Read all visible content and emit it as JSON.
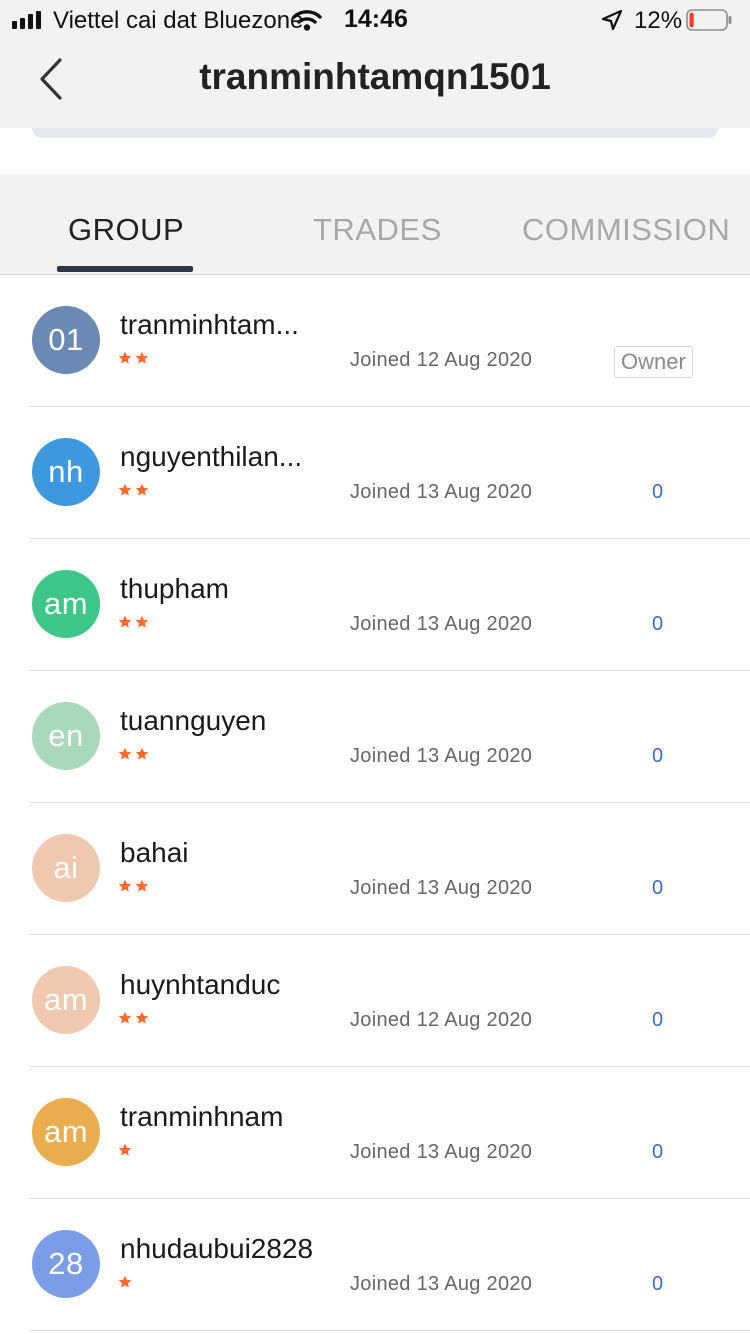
{
  "status_bar": {
    "carrier": "Viettel cai dat Bluezone",
    "time": "14:46",
    "battery_percent": "12%",
    "battery_level": 0.12,
    "battery_color": "#ff3b30",
    "icons": [
      "signal-icon",
      "wifi-icon",
      "location-arrow-icon",
      "battery-icon"
    ]
  },
  "header": {
    "title": "tranminhtamqn1501",
    "back_icon": "chevron-left-icon"
  },
  "tabs": [
    {
      "label": "GROUP",
      "active": true
    },
    {
      "label": "TRADES",
      "active": false
    },
    {
      "label": "COMMISSION",
      "active": false
    }
  ],
  "colors": {
    "star": "#ff6a2b",
    "link_value": "#3b6cc4",
    "tab_indicator": "#2e3648"
  },
  "members": [
    {
      "initials": "01",
      "avatar_color": "#6a8ab5",
      "name": "tranminhtam...",
      "stars": 2,
      "joined": "Joined 12 Aug 2020",
      "value": "Owner",
      "is_badge": true
    },
    {
      "initials": "nh",
      "avatar_color": "#3d98e0",
      "name": "nguyenthilan...",
      "stars": 2,
      "joined": "Joined 13 Aug 2020",
      "value": "0",
      "is_badge": false
    },
    {
      "initials": "am",
      "avatar_color": "#3ec689",
      "name": "thupham",
      "stars": 2,
      "joined": "Joined 13 Aug 2020",
      "value": "0",
      "is_badge": false
    },
    {
      "initials": "en",
      "avatar_color": "#a9d8ba",
      "name": "tuannguyen",
      "stars": 2,
      "joined": "Joined 13 Aug 2020",
      "value": "0",
      "is_badge": false
    },
    {
      "initials": "ai",
      "avatar_color": "#f0c8b0",
      "name": "bahai",
      "stars": 2,
      "joined": "Joined 13 Aug 2020",
      "value": "0",
      "is_badge": false
    },
    {
      "initials": "am",
      "avatar_color": "#f0c8b0",
      "name": "huynhtanduc",
      "stars": 2,
      "joined": "Joined 12 Aug 2020",
      "value": "0",
      "is_badge": false
    },
    {
      "initials": "am",
      "avatar_color": "#e9ad50",
      "name": "tranminhnam",
      "stars": 1,
      "joined": "Joined 13 Aug 2020",
      "value": "0",
      "is_badge": false
    },
    {
      "initials": "28",
      "avatar_color": "#7b9ce6",
      "name": "nhudaubui2828",
      "stars": 1,
      "joined": "Joined 13 Aug 2020",
      "value": "0",
      "is_badge": false
    }
  ]
}
